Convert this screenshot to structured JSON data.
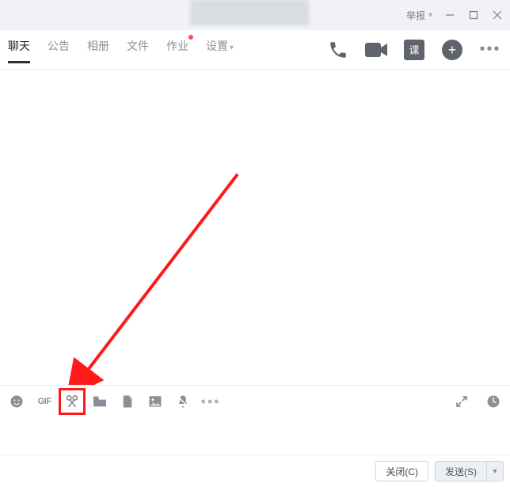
{
  "titlebar": {
    "report_label": "举报"
  },
  "tabs": {
    "items": [
      {
        "label": "聊天",
        "active": true
      },
      {
        "label": "公告"
      },
      {
        "label": "相册"
      },
      {
        "label": "文件"
      },
      {
        "label": "作业",
        "dot": true
      },
      {
        "label": "设置",
        "dropdown": true
      }
    ]
  },
  "action_icons": {
    "course_label": "课"
  },
  "footer": {
    "close_label": "关闭(C)",
    "send_label": "发送(S)"
  },
  "toolbar": {
    "gif_label": "GIF"
  }
}
